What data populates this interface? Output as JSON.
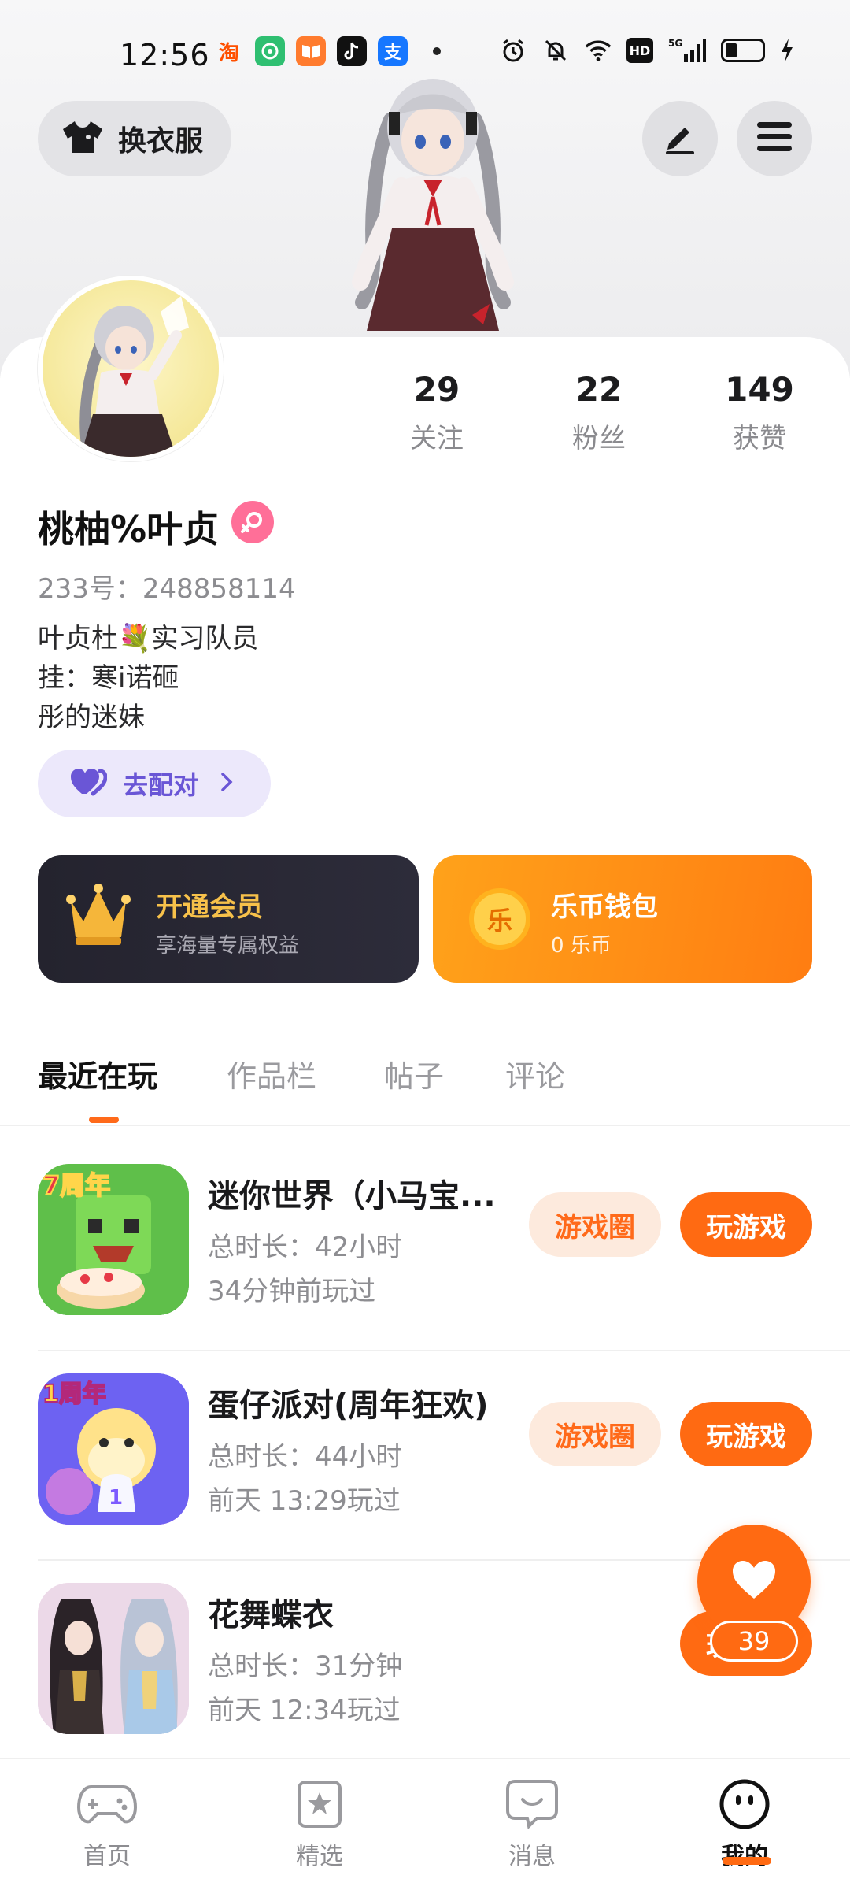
{
  "status_bar": {
    "time": "12:56",
    "apps": [
      {
        "name": "taobao-icon",
        "glyph": "淘",
        "bg": "#ffffff",
        "fg": "#ff5000"
      },
      {
        "name": "app-icon-green",
        "glyph": "",
        "bg": "#2fbf71",
        "fg": "#ffffff"
      },
      {
        "name": "book-app-icon",
        "glyph": "",
        "bg": "#ff7b2e",
        "fg": "#ffffff"
      },
      {
        "name": "tiktok-icon",
        "glyph": "♪",
        "bg": "#111111",
        "fg": "#ffffff"
      },
      {
        "name": "alipay-icon",
        "glyph": "支",
        "bg": "#1677ff",
        "fg": "#ffffff"
      }
    ],
    "hd": "HD",
    "network": "5G"
  },
  "header": {
    "outfit_label": "换衣服"
  },
  "stats": [
    {
      "value": "29",
      "label": "关注"
    },
    {
      "value": "22",
      "label": "粉丝"
    },
    {
      "value": "149",
      "label": "获赞"
    }
  ],
  "profile": {
    "nickname": "桃柚%叶贞",
    "uid": "233号：248858114",
    "bio": [
      "叶贞杜💐实习队员",
      "挂：寒i诺砸",
      "彤的迷妹"
    ],
    "match_label": "去配对"
  },
  "vip_card": {
    "title": "开通会员",
    "subtitle": "享海量专属权益"
  },
  "coin_card": {
    "title": "乐币钱包",
    "subtitle": "0 乐币",
    "coin_glyph": "乐"
  },
  "tabs": [
    "最近在玩",
    "作品栏",
    "帖子",
    "评论"
  ],
  "games": [
    {
      "title": "迷你世界（小马宝...",
      "duration": "总时长：42小时",
      "last_played": "34分钟前玩过",
      "circle_label": "游戏圈",
      "play_label": "玩游戏",
      "icon_badge": "7周年"
    },
    {
      "title": "蛋仔派对(周年狂欢)",
      "duration": "总时长：44小时",
      "last_played": "前天 13:29玩过",
      "circle_label": "游戏圈",
      "play_label": "玩游戏",
      "icon_badge": "1周年"
    },
    {
      "title": "花舞蝶衣",
      "duration": "总时长：31分钟",
      "last_played": "前天 12:34玩过",
      "play_label": "玩游戏"
    }
  ],
  "fab": {
    "count": "39"
  },
  "bottom_nav": [
    {
      "label": "首页"
    },
    {
      "label": "精选"
    },
    {
      "label": "消息"
    },
    {
      "label": "我的"
    }
  ],
  "colors": {
    "accent": "#ff6a12",
    "vip_bg": "#24232e",
    "vip_text": "#f7c14a",
    "coin_bg": "#ff8f16",
    "match_text": "#6a56d6",
    "gender_badge": "#ff6f98"
  }
}
